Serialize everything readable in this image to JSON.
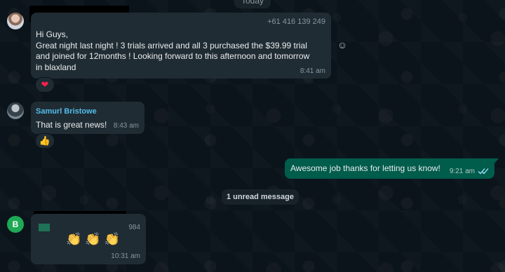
{
  "day_chip": "Today",
  "messages": [
    {
      "phone": "+61 416 139 249",
      "text": "Hi Guys,\nGreat night last night ! 3 trials arrived and all 3 purchased the $39.99 trial\nand joined for 12months ! Looking forward to this afternoon and tomorrow\nin blaxland",
      "time": "8:41 am",
      "reaction": "❤"
    },
    {
      "sender": "Samurl Bristowe",
      "text": "That is great news!",
      "time": "8:43 am",
      "reaction": "👍"
    },
    {
      "text": "Awesome job thanks for letting us know!",
      "time": "9:21 am"
    },
    {
      "phone": "984",
      "time": "10:31 am"
    }
  ],
  "unread_label": "1 unread message",
  "avatar_letter": "B",
  "icons": {
    "emoji": "☺",
    "read_status": "double-check-icon"
  },
  "colors": {
    "background": "#0b141a",
    "incoming_bubble": "#202c33",
    "outgoing_bubble": "#005c4b",
    "sender_name": "#53bdeb"
  }
}
